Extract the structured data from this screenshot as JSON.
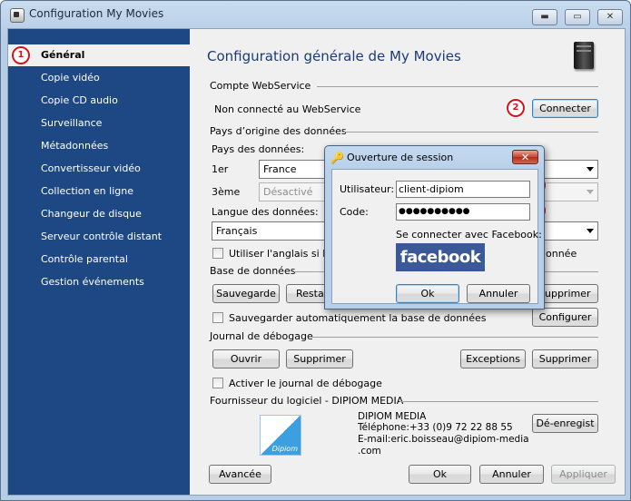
{
  "window": {
    "title": "Configuration My Movies",
    "controls": {
      "minimize": "▬",
      "maximize": "▭",
      "close": "✕"
    }
  },
  "sidebar": {
    "items": [
      {
        "label": "Général",
        "active": true
      },
      {
        "label": "Copie vidéo"
      },
      {
        "label": "Copie CD audio"
      },
      {
        "label": "Surveillance"
      },
      {
        "label": "Métadonnées"
      },
      {
        "label": "Convertisseur vidéo"
      },
      {
        "label": "Collection en ligne"
      },
      {
        "label": "Changeur de disque"
      },
      {
        "label": "Serveur contrôle distant"
      },
      {
        "label": "Contrôle parental"
      },
      {
        "label": "Gestion événements"
      }
    ]
  },
  "badges": [
    "1",
    "2",
    "3",
    "4"
  ],
  "main": {
    "title": "Configuration générale de My Movies",
    "webservice": {
      "section": "Compte WebService",
      "status": "Non connecté au WebService",
      "connect_button": "Connecter"
    },
    "origin": {
      "section": "Pays d’origine des données",
      "countries_label": "Pays des données:",
      "first_label": "1er",
      "first_value": "France",
      "third_label": "3ème",
      "third_value": "Désactivé",
      "language_label": "Langue des données:",
      "language_value": "Français",
      "english_option_start": "Utiliser l'anglais si le",
      "english_option_end": "onnée"
    },
    "database": {
      "section": "Base de données",
      "save_button": "Sauvegarde",
      "restore_button": "Resta",
      "delete_button": "upprimer",
      "auto_save_label": "Sauvegarder automatiquement la base de données",
      "configure_button": "Configurer"
    },
    "debug": {
      "section": "Journal de débogage",
      "open_button": "Ouvrir",
      "delete_button": "Supprimer",
      "exceptions_button": "Exceptions",
      "delete2_button": "Supprimer",
      "enable_label": "Activer le journal de débogage"
    },
    "vendor": {
      "section": "Fournisseur du logiciel - DIPIOM MEDIA",
      "logo_text": "Dipiom",
      "name": "DIPIOM MEDIA",
      "phone": "Téléphone:+33 (0)9 72 22 88 55",
      "email": "E-mail:eric.boisseau@dipiom-media",
      "email_cont": ".com",
      "unregister_button": "Dé-enregist"
    },
    "footer": {
      "advanced_button": "Avancée",
      "ok_button": "Ok",
      "cancel_button": "Annuler",
      "apply_button": "Appliquer"
    }
  },
  "login_dialog": {
    "title": "Ouverture de session",
    "user_label": "Utilisateur:",
    "user_value": "client-dipiom",
    "code_label": "Code:",
    "code_value": "●●●●●●●●●●",
    "facebook_label": "Se connecter avec Facebook:",
    "facebook_logo": "facebook",
    "ok_button": "Ok",
    "cancel_button": "Annuler"
  },
  "icons": [
    "app-icon",
    "server-icon",
    "key-icon",
    "close-icon",
    "chevron-down-icon",
    "facebook-logo",
    "dipiom-logo"
  ]
}
